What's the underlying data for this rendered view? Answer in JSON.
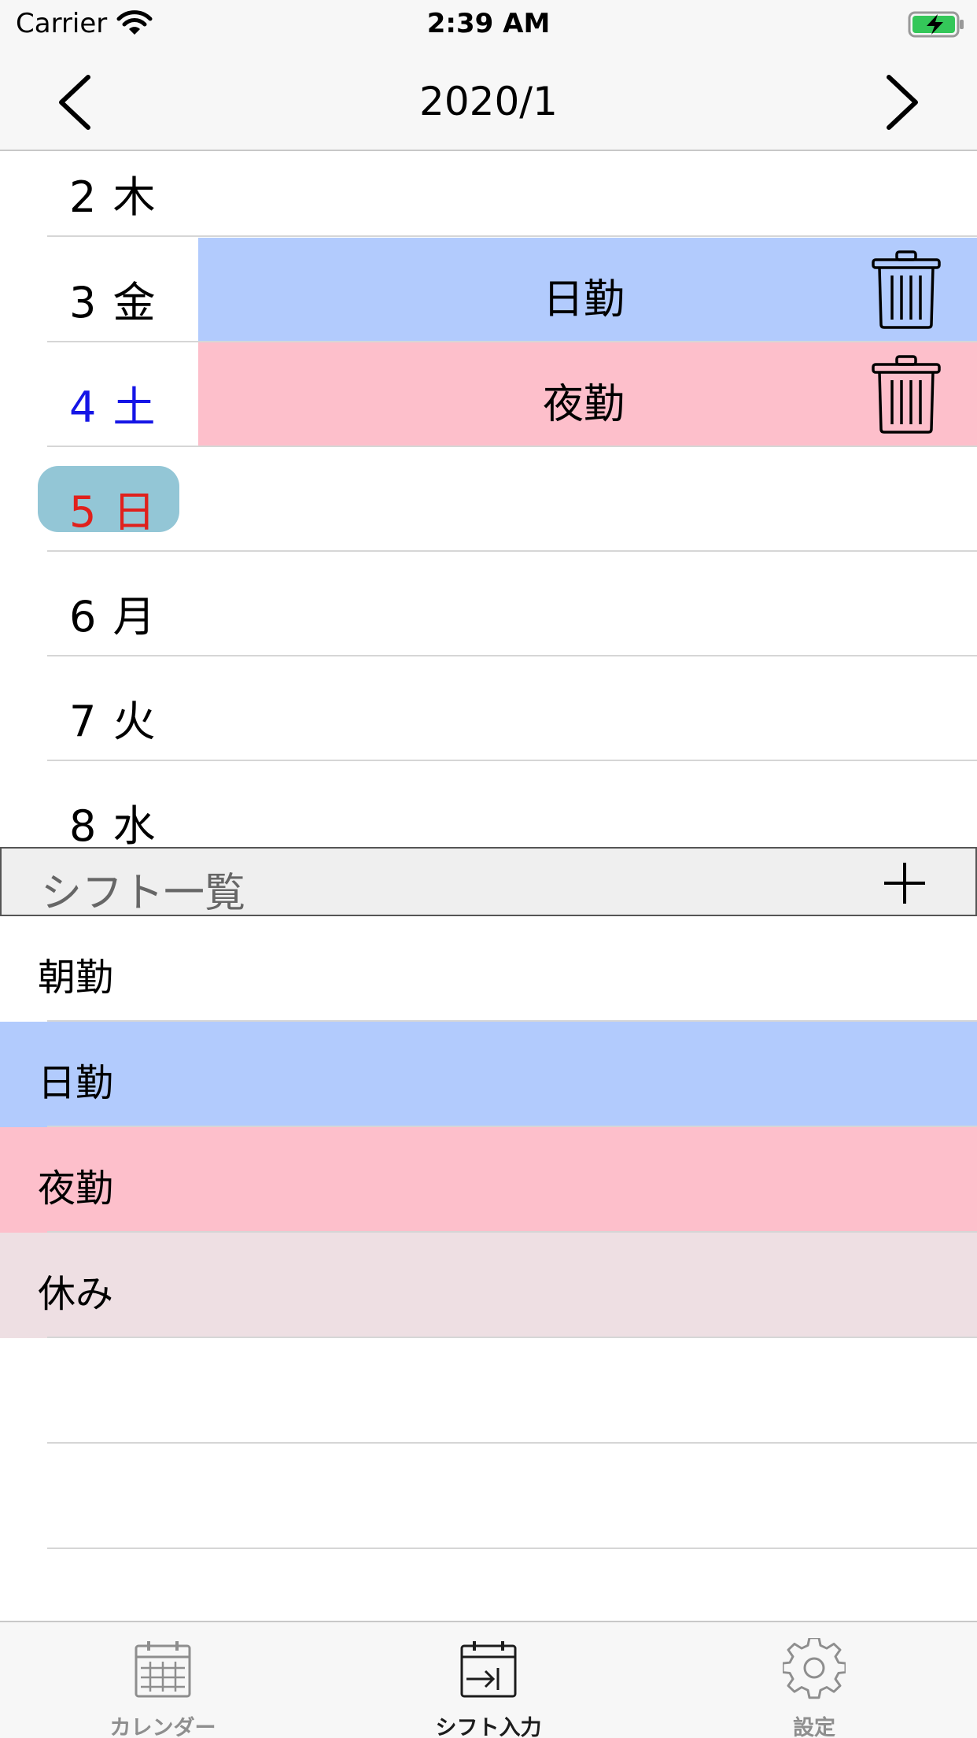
{
  "status_bar": {
    "carrier": "Carrier",
    "time": "2:39 AM"
  },
  "nav": {
    "title": "2020/1",
    "prev_icon": "chevron-left-icon",
    "next_icon": "chevron-right-icon"
  },
  "days": [
    {
      "label": "2 木",
      "color": "#000000",
      "shift": "",
      "shift_color": ""
    },
    {
      "label": "3 金",
      "color": "#000000",
      "shift": "日勤",
      "shift_color": "#b2cbfd"
    },
    {
      "label": "4 土",
      "color": "#1515e6",
      "shift": "夜勤",
      "shift_color": "#fdbfcb"
    },
    {
      "label": "5 日",
      "color": "#e0201c",
      "shift": "",
      "shift_color": "",
      "today": true
    },
    {
      "label": "6 月",
      "color": "#000000",
      "shift": "",
      "shift_color": ""
    },
    {
      "label": "7 火",
      "color": "#000000",
      "shift": "",
      "shift_color": ""
    },
    {
      "label": "8 水",
      "color": "#000000",
      "shift": "",
      "shift_color": ""
    }
  ],
  "shift_list": {
    "title": "シフト一覧",
    "add_icon": "plus-icon",
    "items": [
      {
        "label": "朝勤",
        "color": "#ffffff"
      },
      {
        "label": "日勤",
        "color": "#b2cbfd"
      },
      {
        "label": "夜勤",
        "color": "#fdbfcb"
      },
      {
        "label": "休み",
        "color": "#eedfe3"
      }
    ]
  },
  "tabs": [
    {
      "label": "カレンダー",
      "icon": "calendar-icon",
      "active": false
    },
    {
      "label": "シフト入力",
      "icon": "calendar-input-icon",
      "active": true
    },
    {
      "label": "設定",
      "icon": "gear-icon",
      "active": false
    }
  ],
  "colors": {
    "accent_today": "#93c6d6",
    "bar_background": "#f7f7f7"
  }
}
